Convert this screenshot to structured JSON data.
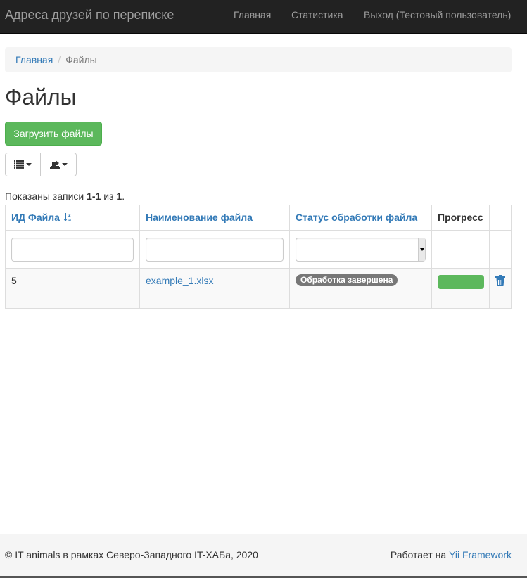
{
  "navbar": {
    "brand": "Адреса друзей по переписке",
    "items": [
      {
        "label": "Главная"
      },
      {
        "label": "Статистика"
      },
      {
        "label": "Выход (Тестовый пользователь)"
      }
    ]
  },
  "breadcrumb": {
    "home": "Главная",
    "separator": "/",
    "current": "Файлы"
  },
  "page": {
    "title": "Файлы",
    "upload_label": "Загрузить файлы"
  },
  "toolbar": {
    "columns_icon": "list-icon",
    "export_icon": "export-icon"
  },
  "summary": {
    "prefix": "Показаны записи ",
    "range": "1-1",
    "middle": " из ",
    "total": "1",
    "suffix": "."
  },
  "table": {
    "columns": [
      {
        "label": "ИД Файла",
        "sortable": true,
        "sorted": "asc"
      },
      {
        "label": "Наименование файла",
        "sortable": true
      },
      {
        "label": "Статус обработки файла",
        "sortable": true
      },
      {
        "label": "Прогресс",
        "sortable": false
      }
    ],
    "filters": {
      "id": "",
      "name": "",
      "status": ""
    },
    "rows": [
      {
        "id": "5",
        "name": "example_1.xlsx",
        "status": "Обработка завершена",
        "progress_percent": 100,
        "action_icon": "trash-icon"
      }
    ]
  },
  "footer": {
    "left": "© IT animals в рамках Северо-Западного IT-ХАБа, 2020",
    "right_prefix": "Работает на ",
    "right_link": "Yii Framework"
  },
  "colors": {
    "navbar_bg": "#222222",
    "link": "#337ab7",
    "success": "#5cb85c",
    "badge": "#777777"
  }
}
